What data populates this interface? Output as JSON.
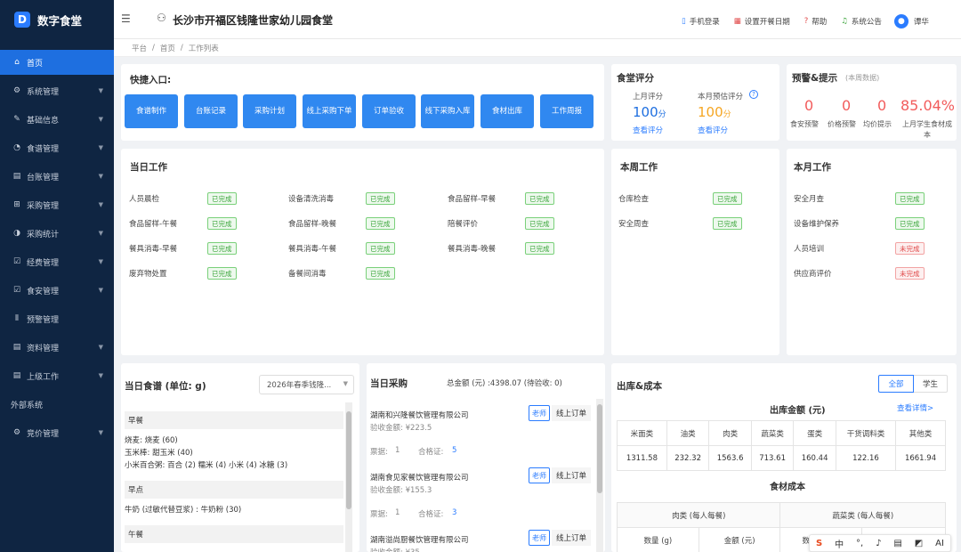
{
  "app": {
    "name": "数字食堂",
    "logo_letter": "D"
  },
  "sidebar": {
    "items": [
      {
        "label": "首页",
        "icon": "home-icon",
        "glyph": "⌂",
        "active": true,
        "chevron": false
      },
      {
        "label": "系统管理",
        "icon": "gear-icon",
        "glyph": "⚙",
        "active": false,
        "chevron": true
      },
      {
        "label": "基础信息",
        "icon": "edit-icon",
        "glyph": "✎",
        "active": false,
        "chevron": true
      },
      {
        "label": "食谱管理",
        "icon": "bulb-icon",
        "glyph": "◔",
        "active": false,
        "chevron": true
      },
      {
        "label": "台账管理",
        "icon": "document-icon",
        "glyph": "▤",
        "active": false,
        "chevron": true
      },
      {
        "label": "采购管理",
        "icon": "cart-icon",
        "glyph": "⊞",
        "active": false,
        "chevron": true
      },
      {
        "label": "采购统计",
        "icon": "pie-icon",
        "glyph": "◑",
        "active": false,
        "chevron": true
      },
      {
        "label": "经费管理",
        "icon": "check-square-icon",
        "glyph": "☑",
        "active": false,
        "chevron": true
      },
      {
        "label": "食安管理",
        "icon": "check-square-icon",
        "glyph": "☑",
        "active": false,
        "chevron": true
      },
      {
        "label": "预警管理",
        "icon": "signal-icon",
        "glyph": "⦀",
        "active": false,
        "chevron": false
      },
      {
        "label": "资料管理",
        "icon": "document-icon",
        "glyph": "▤",
        "active": false,
        "chevron": true
      },
      {
        "label": "上级工作",
        "icon": "document-icon",
        "glyph": "▤",
        "active": false,
        "chevron": true
      },
      {
        "label": "外部系统",
        "icon": "",
        "glyph": "",
        "active": false,
        "chevron": false
      },
      {
        "label": "竞价管理",
        "icon": "gear-icon",
        "glyph": "⚙",
        "active": false,
        "chevron": true
      }
    ]
  },
  "header": {
    "title": "长沙市开福区钱隆世家幼儿园食堂",
    "actions": [
      {
        "label": "手机登录",
        "icon": "phone-icon"
      },
      {
        "label": "设置开餐日期",
        "icon": "calendar-icon"
      },
      {
        "label": "帮助",
        "icon": "help-icon"
      },
      {
        "label": "系统公告",
        "icon": "bell-icon"
      }
    ],
    "user": "谭华"
  },
  "breadcrumb": [
    "平台",
    "首页",
    "工作列表"
  ],
  "quick": {
    "title": "快捷入口:",
    "buttons": [
      "食谱制作",
      "台账记录",
      "采购计划",
      "线上采购下单",
      "订单验收",
      "线下采购入库",
      "食材出库",
      "工作周报"
    ]
  },
  "rating": {
    "title": "食堂评分",
    "last_label": "上月评分",
    "last_value": "100",
    "last_unit": "分",
    "last_link": "查看评分",
    "pred_label": "本月预估评分",
    "pred_value": "100",
    "pred_unit": "分",
    "pred_link": "查看评分"
  },
  "alert": {
    "title": "预警&提示",
    "subtitle": "(本周数据)",
    "items": [
      {
        "value": "0",
        "label": "食安预警"
      },
      {
        "value": "0",
        "label": "价格预警"
      },
      {
        "value": "0",
        "label": "均价提示"
      },
      {
        "value": "85.04%",
        "label": "上月学生食材成本"
      }
    ]
  },
  "today_work": {
    "title": "当日工作",
    "items": [
      {
        "name": "人员晨检",
        "status": "已完成",
        "done": true
      },
      {
        "name": "设备清洗消毒",
        "status": "已完成",
        "done": true
      },
      {
        "name": "食品留样-早餐",
        "status": "已完成",
        "done": true
      },
      {
        "name": "食品留样-午餐",
        "status": "已完成",
        "done": true
      },
      {
        "name": "食品留样-晚餐",
        "status": "已完成",
        "done": true
      },
      {
        "name": "陪餐评价",
        "status": "已完成",
        "done": true
      },
      {
        "name": "餐具消毒-早餐",
        "status": "已完成",
        "done": true
      },
      {
        "name": "餐具消毒-午餐",
        "status": "已完成",
        "done": true
      },
      {
        "name": "餐具消毒-晚餐",
        "status": "已完成",
        "done": true
      },
      {
        "name": "废弃物处置",
        "status": "已完成",
        "done": true
      },
      {
        "name": "备餐间消毒",
        "status": "已完成",
        "done": true
      }
    ]
  },
  "week_work": {
    "title": "本周工作",
    "items": [
      {
        "name": "仓库检查",
        "status": "已完成",
        "done": true
      },
      {
        "name": "安全周查",
        "status": "已完成",
        "done": true
      }
    ]
  },
  "month_work": {
    "title": "本月工作",
    "items": [
      {
        "name": "安全月查",
        "status": "已完成",
        "done": true
      },
      {
        "name": "设备维护保养",
        "status": "已完成",
        "done": true
      },
      {
        "name": "人员培训",
        "status": "未完成",
        "done": false
      },
      {
        "name": "供应商评价",
        "status": "未完成",
        "done": false
      }
    ]
  },
  "recipe": {
    "title": "当日食谱 (单位: g)",
    "select_value": "2026年春季钱隆...",
    "sections": [
      {
        "name": "早餐",
        "lines": [
          "烧麦: 烧麦 (60)",
          "玉米棒: 甜玉米 (40)",
          "小米百合粥: 百合 (2) 糯米 (4) 小米 (4) 冰糖 (3)"
        ]
      },
      {
        "name": "早点",
        "lines": [
          "牛奶 (过敏代替豆浆) : 牛奶粉 (30)"
        ]
      },
      {
        "name": "午餐",
        "lines": []
      }
    ]
  },
  "purchase": {
    "title": "当日采购",
    "total": "总金额 (元) :4398.07 (待验收: 0)",
    "items": [
      {
        "company": "湖南和兴隆餐饮管理有限公司",
        "amount": "验收金额: ¥223.5",
        "tickets_label": "票据: ",
        "tickets": "1",
        "cert_label": "合格证: ",
        "cert": "5",
        "tag": "老师",
        "type": "线上订单"
      },
      {
        "company": "湖南食见家餐饮管理有限公司",
        "amount": "验收金额: ¥155.3",
        "tickets_label": "票据: ",
        "tickets": "1",
        "cert_label": "合格证: ",
        "cert": "3",
        "tag": "老师",
        "type": "线上订单"
      },
      {
        "company": "湖南溢尚厨餐饮管理有限公司",
        "amount": "验收金额: ¥35",
        "tickets_label": "",
        "tickets": "",
        "cert_label": "",
        "cert": "",
        "tag": "老师",
        "type": "线上订单"
      }
    ]
  },
  "outbound": {
    "title": "出库&成本",
    "tabs": [
      "全部",
      "学生"
    ],
    "amount_title": "出库金额 (元)",
    "detail_link": "查看详情>",
    "columns": [
      "米面类",
      "油类",
      "肉类",
      "蔬菜类",
      "蛋类",
      "干货调料类",
      "其他类"
    ],
    "values": [
      "1311.58",
      "232.32",
      "1563.6",
      "713.61",
      "160.44",
      "122.16",
      "1661.94"
    ],
    "cost_title": "食材成本",
    "cost_groups": [
      "肉类 (每人每餐)",
      "蔬菜类 (每人每餐)"
    ],
    "cost_sub": [
      "数量 (g)",
      "金额 (元)",
      "数"
    ]
  },
  "colors": {
    "accent": "#1e6fe0",
    "sidebar": "#0f2542",
    "red": "#f25c5c",
    "orange": "#f5a623"
  }
}
